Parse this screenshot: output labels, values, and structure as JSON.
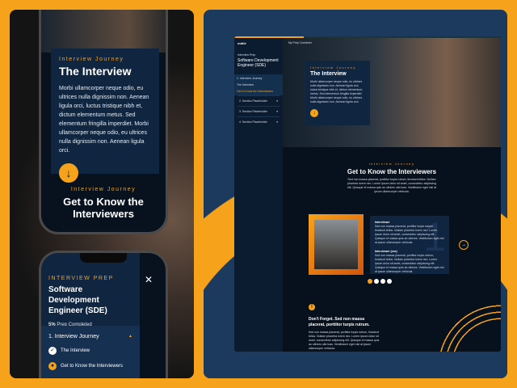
{
  "mobile_top": {
    "eyebrow": "Interview Journey",
    "title": "The Interview",
    "body": "Morbi ullamcorper neque odio, eu ultrices nulla dignissim non. Aenean ligula orci, luctus tristique nibh et, dictum elementum metus. Sed elementum fringilla imperdiet. Morbi ullamcorper neque odio, eu ultrices nulla dignissim non. Aenean ligula orci.",
    "next_eyebrow": "Interview Journey",
    "next_title": "Get to Know the Interviewers"
  },
  "mobile_menu": {
    "eyebrow": "INTERVIEW PREP",
    "title": "Software Development Engineer (SDE)",
    "progress_value": "5%",
    "progress_label": "Prep Completed",
    "progress_percent": 5,
    "section": "1. Interview Journey",
    "items": [
      "The Interview",
      "Get to Know the Interviewers"
    ]
  },
  "desktop": {
    "logo": "ouble",
    "header_link": "My Prep Container",
    "sidebar": {
      "eyebrow": "Interview Prep",
      "title": "Software Development Engineer (SDE)",
      "section": "1. Interview Journey",
      "items": [
        "The Interview",
        "Get to Know the Interviewers"
      ],
      "collapsed": [
        "2. Section Placeholder",
        "3. Section Placeholder",
        "4. Section Placeholder"
      ]
    },
    "hero": {
      "eyebrow": "Interview Journey",
      "title": "The Interview",
      "body": "Morbi ullamcorper neque odio, eu ultrices nulla dignissim non. Aenean ligula orci, luctus tristique nibh et, dictum elementum metus. Sed elementum fringilla imperdiet. Morbi ullamcorper neque odio, eu ultrices nulla dignissim non. Aenean ligula orci."
    },
    "section": {
      "eyebrow": "Interview Journey",
      "title": "Get to Know the Interviewers",
      "body": "Sed non massa placerat, porttitor turpis rutrum, tincidunt tellus. Nullam pharetra lorem nec. Lorem ipsum dolor sit amet, consectetur adipiscing elit. Quisque et massa quis an ultrices ulla tuas. Vestibulum eget nisl at ipsum ullamcorper vehicula."
    },
    "interviewers": [
      {
        "name": "Interviewer",
        "body": "Sed non massa placerat, porttitor turpis rutrum, tincidunt tellus. Nullam pharetra lorem nec. Lorem ipsum dolor sit amet, consectetur adipiscing elit. Quisque et massa quis an ultrices. Vestibulum eget nisl at ipsum ullamcorper vehicula."
      },
      {
        "name": "Interviewer (xxx)",
        "body": "Sed non massa placerat, porttitor turpis rutrum, tincidunt tellus. Nullam pharetra lorem nec. Lorem ipsum dolor sit amet, consectetur adipiscing elit. Quisque et massa quis an ultrices. Vestibulum eget nisl at ipsum ullamcorper vehicula."
      }
    ],
    "slide_number": "1",
    "alert": {
      "title": "Don't Forget. Sed non massa placerat, porttitor turpis rutrum.",
      "body": "Sed non massa placerat, porttitor turpis rutrum, tincidunt tellus. Nullam pharetra lorem nec. Lorem ipsum dolor sit amet, consectetur adipiscing elit. Quisque et massa quis an ultrices ulla tuas. Vestibulum eget nisl at ipsum ullamcorper vehicula."
    },
    "progress_percent": 26
  },
  "colors": {
    "accent": "#f7a21b",
    "navy": "#0f2540",
    "background": "#07111d"
  }
}
